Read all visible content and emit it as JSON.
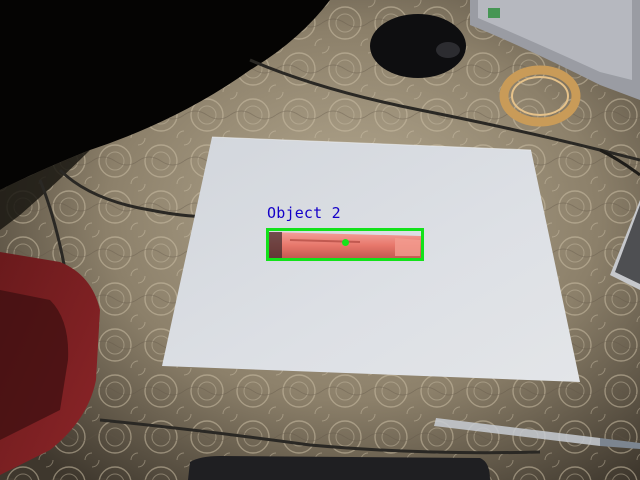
{
  "detection": {
    "label": "Object 2",
    "box_color": "#12e21a",
    "label_color": "#1400c8",
    "center_marker_color": "#18e31a"
  },
  "scene": {
    "paper_color": "#d9dde3",
    "highlighter_color": "#e8786c",
    "tablecloth_color": "#a69880",
    "background_color": "#000000"
  }
}
